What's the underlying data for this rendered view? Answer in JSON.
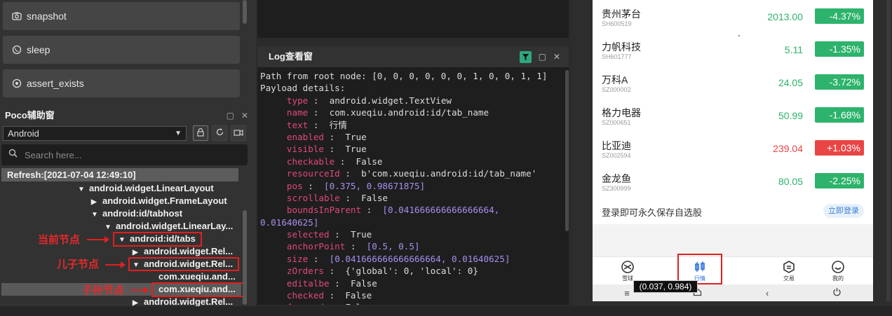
{
  "commands": [
    {
      "label": "snapshot",
      "icon": "camera-icon"
    },
    {
      "label": "sleep",
      "icon": "moon-icon"
    },
    {
      "label": "assert_exists",
      "icon": "target-icon"
    }
  ],
  "poco": {
    "title": "Poco辅助窗",
    "platform": "Android",
    "search_placeholder": "Search here...",
    "refresh": "Refresh:[2021-07-04 12:49:10]",
    "tree": [
      {
        "label": "android.widget.LinearLayout",
        "arrow": "▼"
      },
      {
        "label": "android.widget.FrameLayout",
        "arrow": "▶"
      },
      {
        "label": "android:id/tabhost",
        "arrow": "▼"
      },
      {
        "label": "android.widget.LinearLay...",
        "arrow": "▼"
      },
      {
        "label": "android:id/tabs",
        "arrow": "▼"
      },
      {
        "label": "android.widget.Rel...",
        "arrow": "▶"
      },
      {
        "label": "android.widget.Rel...",
        "arrow": "▼"
      },
      {
        "label": "com.xueqiu.and...",
        "arrow": ""
      },
      {
        "label": "com.xueqiu.and...",
        "arrow": ""
      },
      {
        "label": "android.widget.Rel...",
        "arrow": "▶"
      }
    ],
    "annotations": {
      "current": "当前节点",
      "child": "儿子节点",
      "descendant": "子孙节点"
    }
  },
  "log": {
    "title": "Log查看窗",
    "path_line": "Path from root node: [0, 0, 0, 0, 0, 0, 1, 0, 0, 1, 1]",
    "payload_line": "Payload details:",
    "fields": [
      {
        "key": "type",
        "sep": " :  ",
        "value": "android.widget.TextView",
        "numeric": false
      },
      {
        "key": "name",
        "sep": " :  ",
        "value": "com.xueqiu.android:id/tab_name",
        "numeric": false
      },
      {
        "key": "text",
        "sep": " :  ",
        "value": "行情",
        "numeric": false
      },
      {
        "key": "enabled",
        "sep": " :  ",
        "value": "True",
        "numeric": false
      },
      {
        "key": "visible",
        "sep": " :  ",
        "value": "True",
        "numeric": false
      },
      {
        "key": "checkable",
        "sep": " :  ",
        "value": "False",
        "numeric": false
      },
      {
        "key": "resourceId",
        "sep": " :  ",
        "value": "b'com.xueqiu.android:id/tab_name'",
        "numeric": false
      },
      {
        "key": "pos",
        "sep": " :  ",
        "value": "[0.375, 0.98671875]",
        "numeric": true
      },
      {
        "key": "scrollable",
        "sep": " :  ",
        "value": "False",
        "numeric": false
      },
      {
        "key": "boundsInParent",
        "sep": " :  ",
        "value": "[0.041666666666666664,",
        "numeric": true
      },
      {
        "key": "",
        "sep": "",
        "value": "0.01640625]",
        "numeric": true,
        "wrap": true
      },
      {
        "key": "selected",
        "sep": " :  ",
        "value": "True",
        "numeric": false
      },
      {
        "key": "anchorPoint",
        "sep": " :  ",
        "value": "[0.5, 0.5]",
        "numeric": true
      },
      {
        "key": "size",
        "sep": " :  ",
        "value": "[0.041666666666666664, 0.01640625]",
        "numeric": true
      },
      {
        "key": "zOrders",
        "sep": " :  ",
        "value": "{'global': 0, 'local': 0}",
        "numeric": false
      },
      {
        "key": "editalbe",
        "sep": " :  ",
        "value": "False",
        "numeric": false
      },
      {
        "key": "checked",
        "sep": " :  ",
        "value": "False",
        "numeric": false
      },
      {
        "key": "focused",
        "sep": " :  ",
        "value": "False",
        "numeric": false
      }
    ]
  },
  "stocks": [
    {
      "name": "贵州茅台",
      "code": "SH600519",
      "price": "2013.00",
      "change": "-4.37%",
      "up": false
    },
    {
      "name": "力帆科技",
      "code": "SH601777",
      "price": "5.11",
      "change": "-1.35%",
      "up": false
    },
    {
      "name": "万科A",
      "code": "SZ000002",
      "price": "24.05",
      "change": "-3.72%",
      "up": false
    },
    {
      "name": "格力电器",
      "code": "SZ000651",
      "price": "50.99",
      "change": "-1.68%",
      "up": false
    },
    {
      "name": "比亚迪",
      "code": "SZ002594",
      "price": "239.04",
      "change": "+1.03%",
      "up": true
    },
    {
      "name": "金龙鱼",
      "code": "SZ300999",
      "price": "80.05",
      "change": "-2.25%",
      "up": false
    }
  ],
  "colors": {
    "down": "#2db36b",
    "up": "#e94545"
  },
  "login": {
    "text": "登录即可永久保存自选股",
    "button": "立即登录"
  },
  "tabs": [
    {
      "label": "雪球",
      "icon": "snowball-icon"
    },
    {
      "label": "行情",
      "icon": "market-icon"
    },
    {
      "label": "交易",
      "icon": "trade-icon"
    },
    {
      "label": "我的",
      "icon": "profile-icon"
    }
  ],
  "tooltip": "(0.037, 0.984)"
}
